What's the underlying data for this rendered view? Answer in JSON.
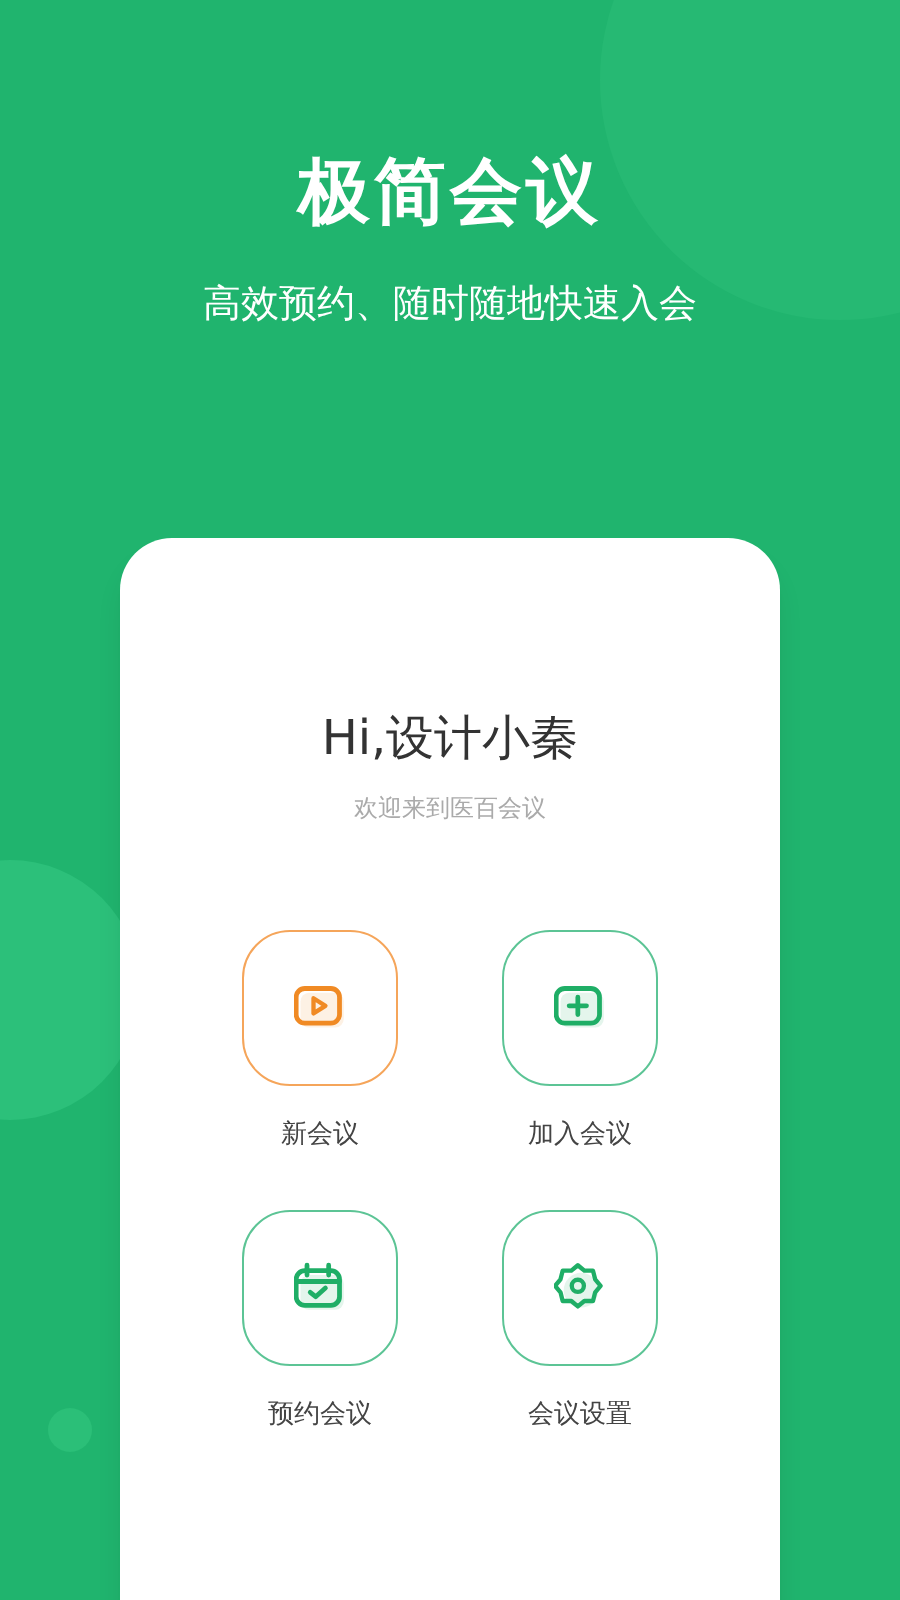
{
  "header": {
    "title": "极简会议",
    "subtitle": "高效预约、随时随地快速入会"
  },
  "card": {
    "greeting": "Hi,设计小秦",
    "welcome": "欢迎来到医百会议",
    "actions": [
      {
        "kind": "new",
        "label": "新会议",
        "selected": true
      },
      {
        "kind": "join",
        "label": "加入会议",
        "selected": false
      },
      {
        "kind": "schedule",
        "label": "预约会议",
        "selected": false
      },
      {
        "kind": "settings",
        "label": "会议设置",
        "selected": false
      }
    ]
  }
}
